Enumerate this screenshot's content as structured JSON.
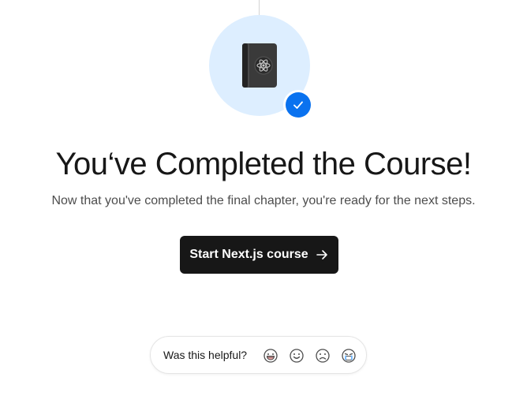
{
  "hero": {
    "icon": "react-book-icon",
    "status_icon": "check-icon",
    "accent_color": "#0a72ef",
    "circle_color": "#ddeeff"
  },
  "title": "You‘ve Completed the Course!",
  "subtitle": "Now that you've completed the final chapter, you're ready for the next steps.",
  "cta": {
    "label": "Start Next.js course",
    "icon": "arrow-right-icon",
    "background": "#171717"
  },
  "feedback": {
    "label": "Was this helpful?",
    "options": [
      {
        "icon": "grinning-face-icon"
      },
      {
        "icon": "smiling-face-icon"
      },
      {
        "icon": "frowning-face-icon"
      },
      {
        "icon": "crying-face-icon"
      }
    ]
  }
}
